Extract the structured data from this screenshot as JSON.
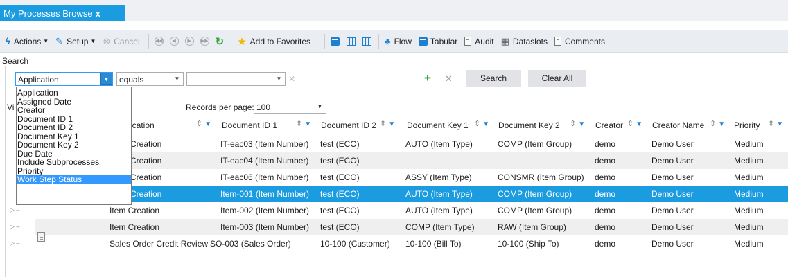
{
  "tab": {
    "title": "My Processes Browse",
    "close": "x"
  },
  "toolbar": {
    "actions": "Actions",
    "setup": "Setup",
    "cancel": "Cancel",
    "add_favorites": "Add to Favorites",
    "flow": "Flow",
    "tabular": "Tabular",
    "audit": "Audit",
    "dataslots": "Dataslots",
    "comments": "Comments"
  },
  "search": {
    "title": "Search",
    "field_value": "Application",
    "operator_value": "equals",
    "value_value": "",
    "search_button": "Search",
    "clear_button": "Clear All",
    "dropdown_options": [
      "Application",
      "Assigned Date",
      "Creator",
      "Document ID 1",
      "Document ID 2",
      "Document Key 1",
      "Document Key 2",
      "Due Date",
      "Include Subprocesses",
      "Priority",
      "Work Step Status"
    ],
    "dropdown_highlighted": "Work Step Status"
  },
  "grid": {
    "view_label_fragment": "Vi",
    "records_per_page_label": "Records per page:",
    "records_per_page_value": "100",
    "columns": [
      "ication",
      "Document ID 1",
      "Document ID 2",
      "Document Key 1",
      "Document Key 2",
      "Creator",
      "Creator Name",
      "Priority"
    ],
    "rows": [
      [
        "Creation",
        "IT-eac03 (Item Number)",
        "test (ECO)",
        "AUTO (Item Type)",
        "COMP (Item Group)",
        "demo",
        "Demo User",
        "Medium"
      ],
      [
        "Creation",
        "IT-eac04 (Item Number)",
        "test (ECO)",
        "",
        "",
        "demo",
        "Demo User",
        "Medium"
      ],
      [
        "Creation",
        "IT-eac06 (Item Number)",
        "test (ECO)",
        "ASSY (Item Type)",
        "CONSMR (Item Group)",
        "demo",
        "Demo User",
        "Medium"
      ],
      [
        "Creation",
        "Item-001 (Item Number)",
        "test (ECO)",
        "AUTO (Item Type)",
        "COMP (Item Group)",
        "demo",
        "Demo User",
        "Medium"
      ],
      [
        "Item Creation",
        "Item-002 (Item Number)",
        "test (ECO)",
        "AUTO (Item Type)",
        "COMP (Item Group)",
        "demo",
        "Demo User",
        "Medium"
      ],
      [
        "Item Creation",
        "Item-003 (Item Number)",
        "test (ECO)",
        "COMP (Item Type)",
        "RAW (Item Group)",
        "demo",
        "Demo User",
        "Medium"
      ],
      [
        "Sales Order Credit Review",
        "SO-003 (Sales Order)",
        "10-100 (Customer)",
        "10-100 (Bill To)",
        "10-100 (Ship To)",
        "demo",
        "Demo User",
        "Medium"
      ]
    ],
    "selected_row": 3
  },
  "colors": {
    "accent": "#1c9ce0",
    "toolbar_bg": "#eaedf2",
    "alt_row": "#efefef"
  }
}
